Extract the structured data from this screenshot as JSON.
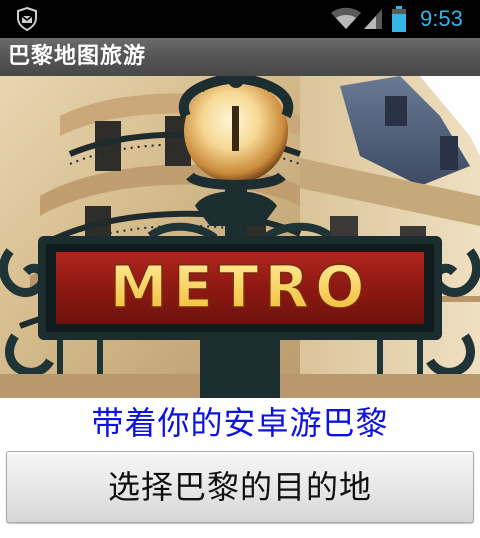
{
  "status_bar": {
    "time": "9:53",
    "icons": [
      "notification-icon",
      "wifi-icon",
      "signal-icon",
      "battery-icon"
    ],
    "accent_color": "#33b5e5"
  },
  "app": {
    "title": "巴黎地图旅游"
  },
  "hero": {
    "sign_text": "METRO",
    "icon": "metro-sign-photo"
  },
  "main": {
    "tagline": "带着你的安卓游巴黎",
    "tagline_color": "#0b12e2",
    "choose_button_label": "选择巴黎的目的地"
  }
}
